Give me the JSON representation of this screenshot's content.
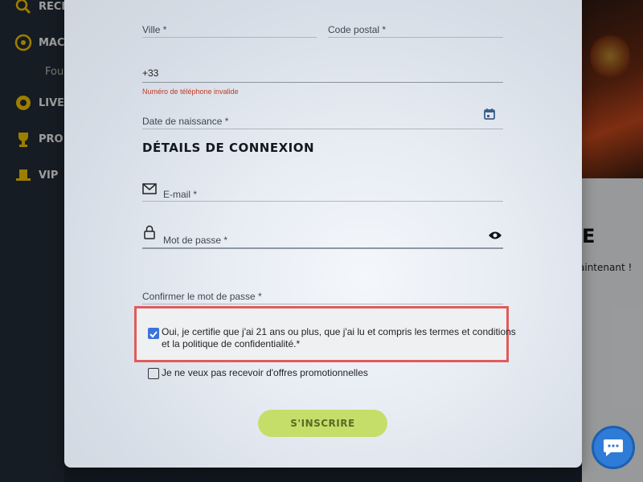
{
  "sidebar": {
    "items": [
      {
        "label": "RECH",
        "icon": "search-icon"
      },
      {
        "label": "MAC",
        "icon": "slot-reel-icon"
      },
      {
        "label": "LIVE",
        "icon": "roulette-icon"
      },
      {
        "label": "PRO",
        "icon": "trophy-icon"
      },
      {
        "label": "VIP",
        "icon": "top-hat-icon"
      }
    ],
    "sub_item": "Fou"
  },
  "background": {
    "big_text": "E",
    "small_text": "aintenant !"
  },
  "form": {
    "city_label": "Ville *",
    "postal_label": "Code postal *",
    "phone_value": "+33",
    "phone_error": "Numéro de téléphone invalide",
    "birthdate_label": "Date de naissance *",
    "section_title": "DÉTAILS DE CONNEXION",
    "email_label": "E-mail *",
    "password_label": "Mot de passe *",
    "confirm_password_label": "Confirmer le mot de passe *",
    "terms_line1": "Oui, je certifie que j'ai 21 ans ou plus, que j'ai lu et compris les termes et conditions",
    "terms_line2": "et la politique de confidentialité.*",
    "terms_checked": true,
    "promo_label": "Je ne veux pas recevoir d'offres promotionnelles",
    "promo_checked": false,
    "submit_label": "S'INSCRIRE"
  },
  "colors": {
    "accent_blue": "#3b73d9",
    "error_red": "#c0392b",
    "submit_green": "#c5de6a",
    "highlight_red": "#e05b5b"
  }
}
